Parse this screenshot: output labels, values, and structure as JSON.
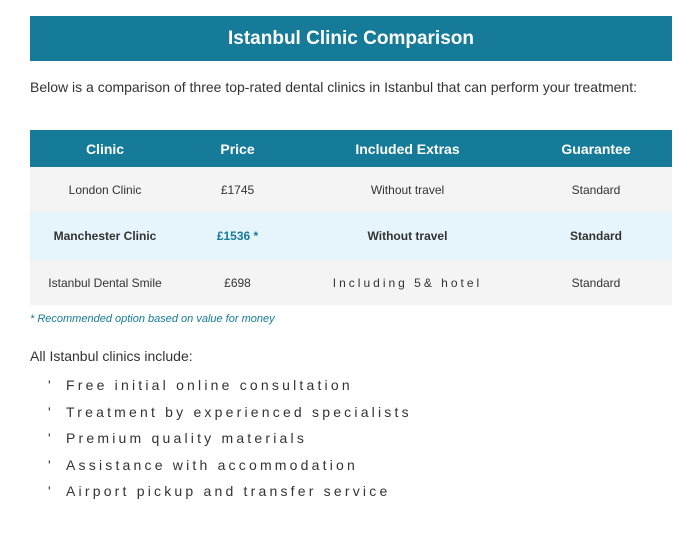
{
  "header": {
    "title": "Istanbul Clinic Comparison"
  },
  "intro": "Below is a comparison of three top-rated dental clinics in Istanbul that can perform your treatment:",
  "table": {
    "columns": [
      "Clinic",
      "Price",
      "Included Extras",
      "Guarantee"
    ],
    "rows": [
      {
        "clinic": "London Clinic",
        "price": "£1745",
        "extras": "Without travel",
        "guarantee": "Standard",
        "highlight": false
      },
      {
        "clinic": "Manchester Clinic",
        "price": "£1536 *",
        "extras": "Without travel",
        "guarantee": "Standard",
        "highlight": true
      },
      {
        "clinic": "Istanbul Dental Smile",
        "price": "£698",
        "extras": "Including 5& hotel",
        "guarantee": "Standard",
        "highlight": false
      }
    ]
  },
  "note": "* Recommended option based on value for money",
  "includes": {
    "title": "All Istanbul clinics include:",
    "bullet": "'",
    "items": [
      "Free initial online consultation",
      "Treatment by experienced specialists",
      "Premium quality materials",
      "Assistance with accommodation",
      "Airport pickup and transfer service"
    ]
  },
  "colors": {
    "accent": "#167b98",
    "row_alt": "#f4f4f4",
    "row_highlight": "#e6f4fb",
    "text": "#333333"
  }
}
